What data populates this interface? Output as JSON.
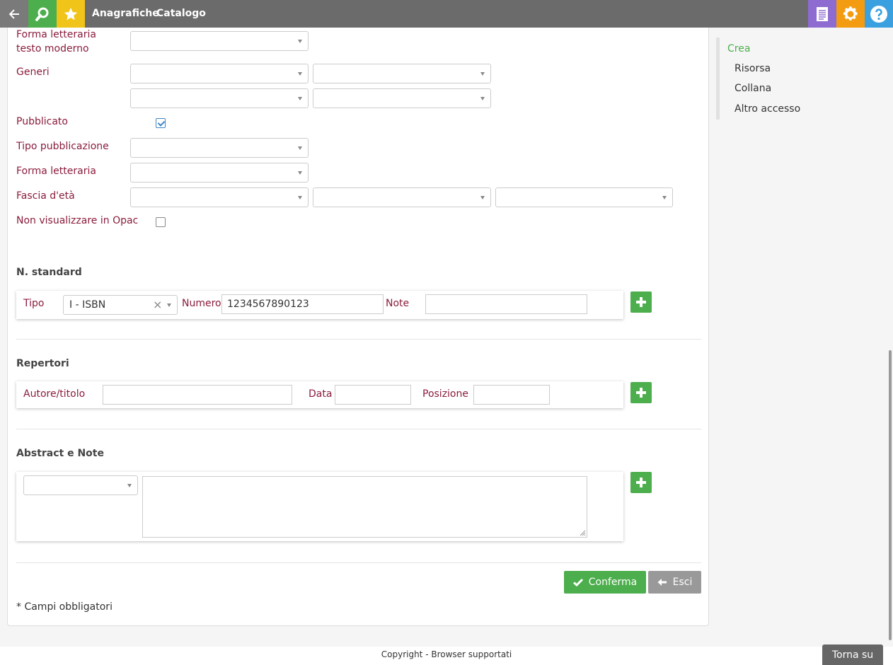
{
  "topbar": {
    "menu": [
      "Anagrafiche",
      "Catalogo"
    ],
    "icons": [
      "back-arrow-icon",
      "search-icon",
      "star-icon",
      "document-icon",
      "gear-icon",
      "help-icon"
    ],
    "colors": {
      "bar": "#6b6b6b",
      "search": "#4cae4c",
      "star": "#f0c419",
      "doc": "#8e6bd1",
      "gear": "#f39c12",
      "help": "#3aa0e0"
    }
  },
  "form": {
    "forma_letteraria_testo_moderno": "Forma letteraria testo moderno",
    "generi": "Generi",
    "pubblicato": "Pubblicato",
    "pubblicato_checked": true,
    "tipo_pubblicazione": "Tipo pubblicazione",
    "forma_letteraria": "Forma letteraria",
    "fascia_eta": "Fascia d'età",
    "non_visualizzare": "Non visualizzare in Opac",
    "non_visualizzare_checked": false
  },
  "standard": {
    "title": "N. standard",
    "tipo_label": "Tipo",
    "tipo_value": "I - ISBN",
    "numero_label": "Numero",
    "numero_value": "1234567890123",
    "note_label": "Note",
    "note_value": ""
  },
  "repertori": {
    "title": "Repertori",
    "autore_label": "Autore/titolo",
    "data_label": "Data",
    "posizione_label": "Posizione"
  },
  "abstract": {
    "title": "Abstract e Note"
  },
  "actions": {
    "confirm": "Conferma",
    "exit": "Esci"
  },
  "required_note": "* Campi obbligatori",
  "sidebar": {
    "heading": "Crea",
    "items": [
      "Risorsa",
      "Collana",
      "Altro accesso"
    ]
  },
  "footer": {
    "text": "Copyright - Browser supportati",
    "back_to_top": "Torna su"
  }
}
